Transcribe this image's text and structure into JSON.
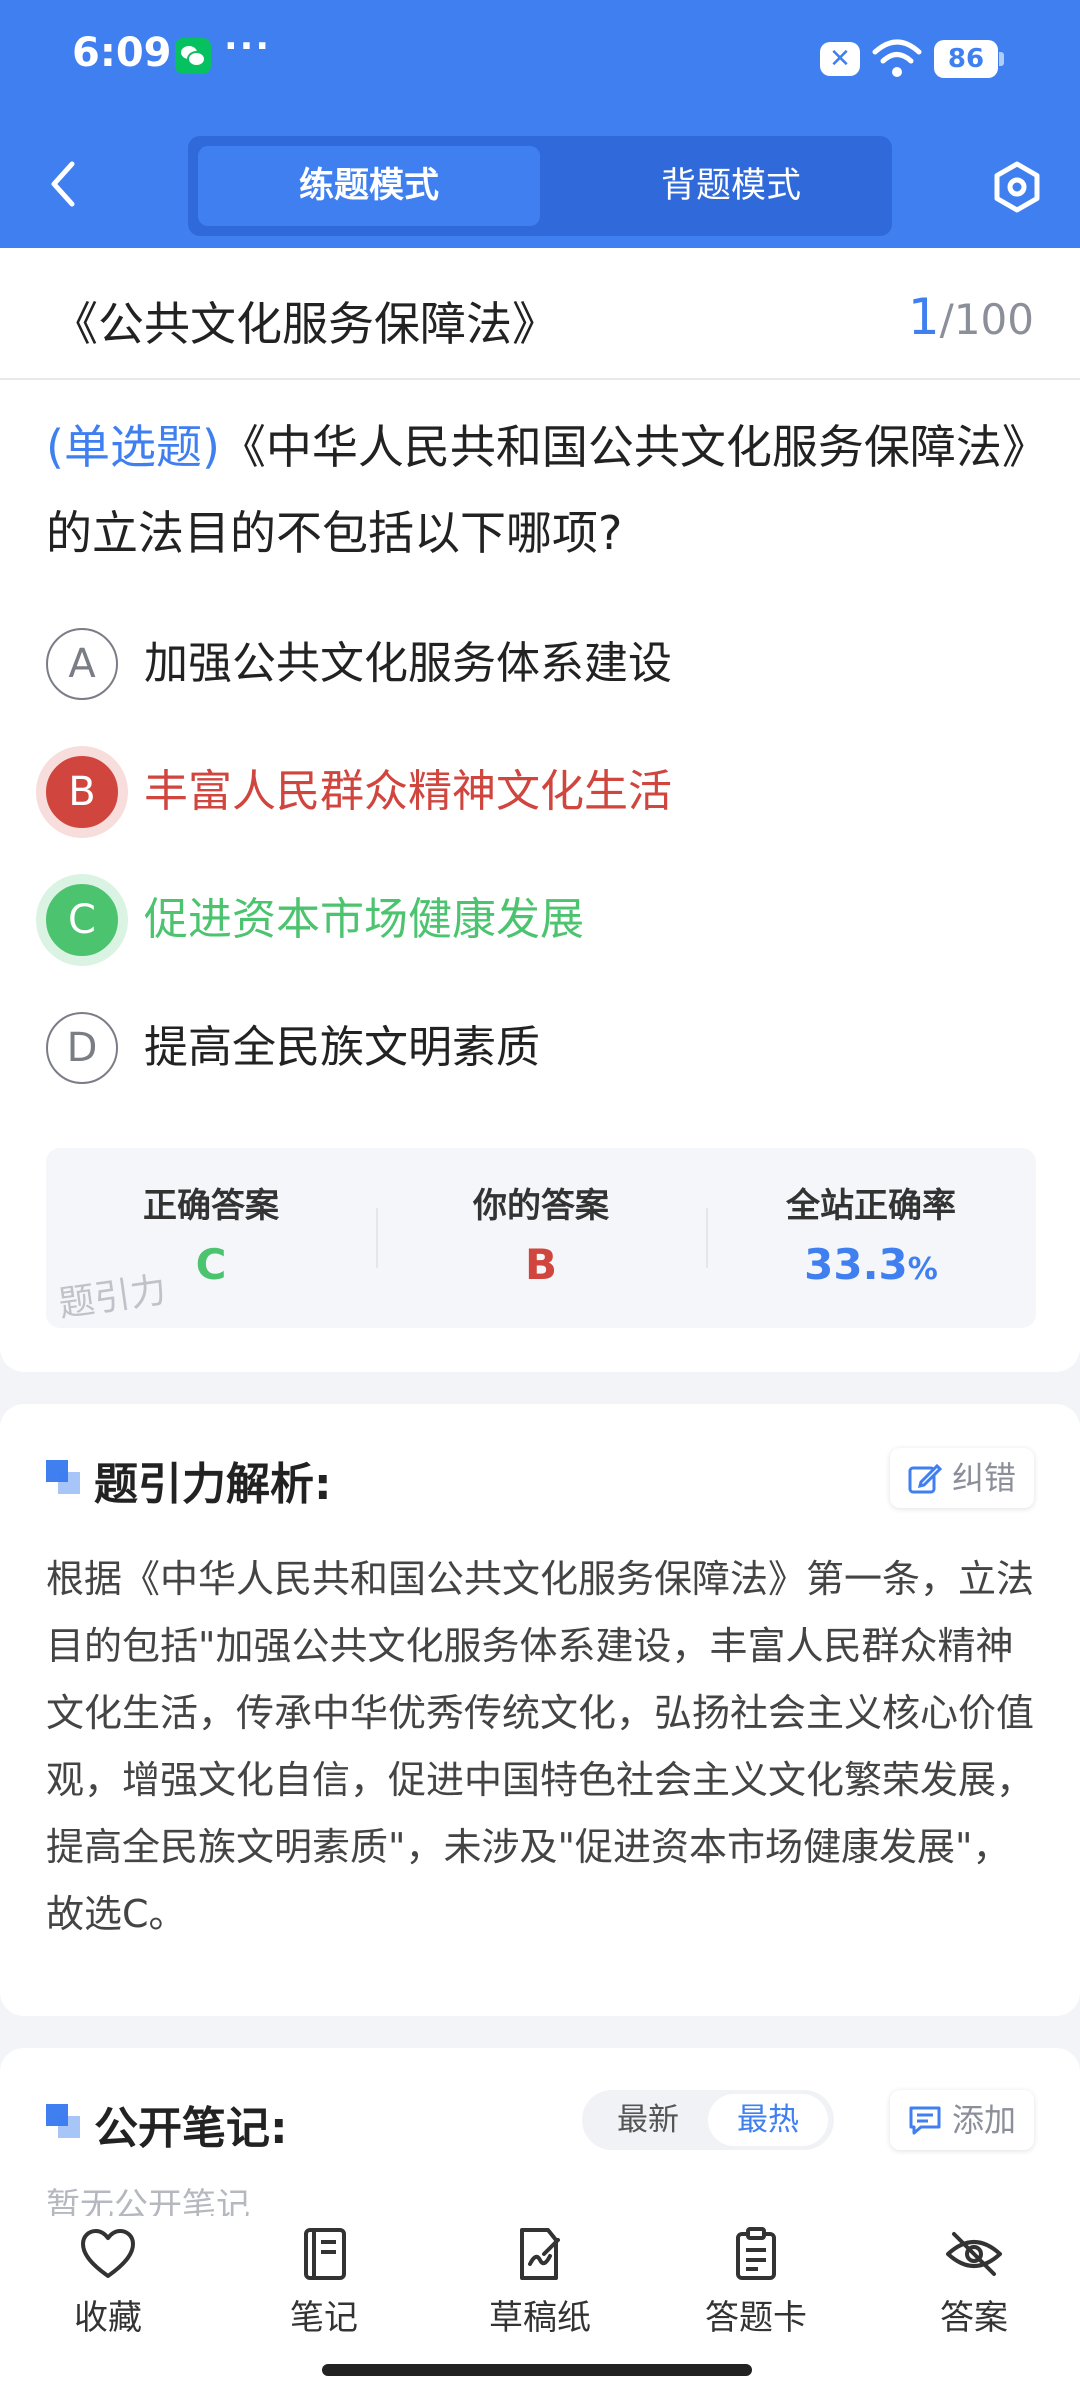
{
  "status_bar": {
    "time": "6:09",
    "more": "···",
    "battery": "86"
  },
  "header": {
    "tabs": [
      {
        "label": "练题模式",
        "active": true
      },
      {
        "label": "背题模式",
        "active": false
      }
    ]
  },
  "question": {
    "law_title": "《公共文化服务保障法》",
    "progress_current": "1",
    "progress_total": "/100",
    "type": "(单选题)",
    "text": "《中华人民共和国公共文化服务保障法》的立法目的不包括以下哪项?",
    "options": [
      {
        "letter": "A",
        "text": "加强公共文化服务体系建设",
        "state": "normal"
      },
      {
        "letter": "B",
        "text": "丰富人民群众精神文化生活",
        "state": "wrong"
      },
      {
        "letter": "C",
        "text": "促进资本市场健康发展",
        "state": "correct"
      },
      {
        "letter": "D",
        "text": "提高全民族文明素质",
        "state": "normal"
      }
    ]
  },
  "answer_summary": {
    "correct_label": "正确答案",
    "correct_value": "C",
    "yours_label": "你的答案",
    "yours_value": "B",
    "rate_label": "全站正确率",
    "rate_value": "33.3",
    "rate_unit": "%",
    "watermark": "题引力"
  },
  "analysis": {
    "title": "题引力解析:",
    "report_label": "纠错",
    "text": "根据《中华人民共和国公共文化服务保障法》第一条，立法目的包括\"加强公共文化服务体系建设，丰富人民群众精神文化生活，传承中华优秀传统文化，弘扬社会主义核心价值观，增强文化自信，促进中国特色社会主义文化繁荣发展，提高全民族文明素质\"，未涉及\"促进资本市场健康发展\"，故选C。"
  },
  "notes": {
    "title": "公开笔记:",
    "sort_options": [
      "最新",
      "最热"
    ],
    "active_sort": "最热",
    "add_label": "添加",
    "empty_text": "暂无公开笔记"
  },
  "bottom_nav": [
    {
      "label": "收藏",
      "icon": "heart-icon"
    },
    {
      "label": "笔记",
      "icon": "notebook-icon"
    },
    {
      "label": "草稿纸",
      "icon": "draft-icon"
    },
    {
      "label": "答题卡",
      "icon": "clipboard-icon"
    },
    {
      "label": "答案",
      "icon": "eye-off-icon"
    }
  ],
  "colors": {
    "primary": "#3f7ff0",
    "wrong": "#d0453d",
    "correct": "#4cc36f"
  }
}
